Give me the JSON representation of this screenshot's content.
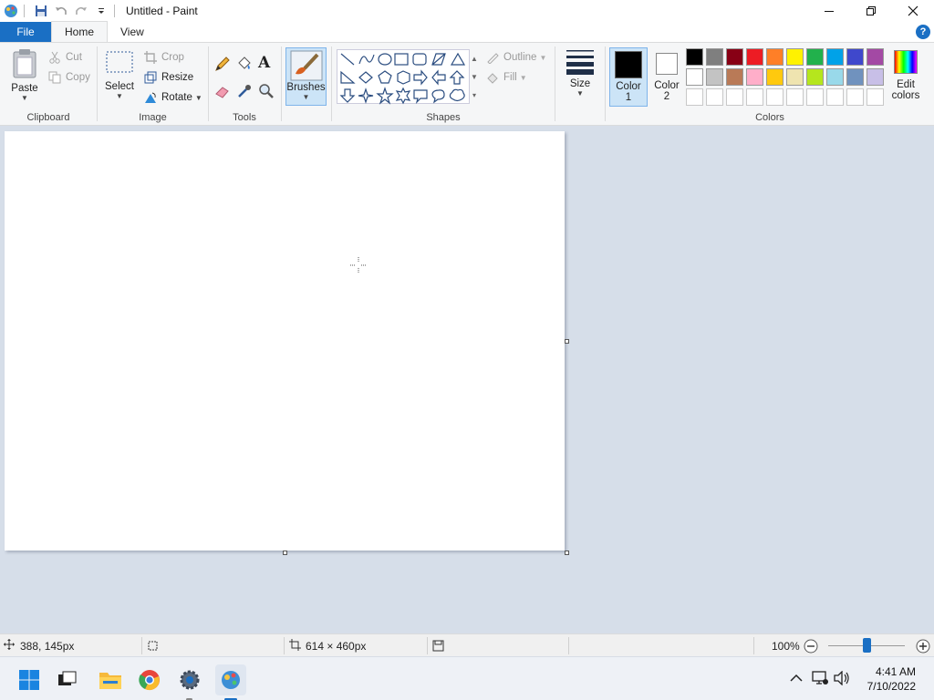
{
  "window": {
    "title": "Untitled - Paint"
  },
  "tabs": {
    "file": "File",
    "home": "Home",
    "view": "View"
  },
  "clipboard": {
    "group_label": "Clipboard",
    "paste": "Paste",
    "cut": "Cut",
    "copy": "Copy"
  },
  "image": {
    "group_label": "Image",
    "select": "Select",
    "crop": "Crop",
    "resize": "Resize",
    "rotate": "Rotate"
  },
  "tools": {
    "group_label": "Tools"
  },
  "brushes": {
    "label": "Brushes"
  },
  "shapes": {
    "group_label": "Shapes",
    "outline": "Outline",
    "fill": "Fill"
  },
  "size": {
    "label": "Size"
  },
  "colors": {
    "group_label": "Colors",
    "color1_label": "Color",
    "color1_num": "1",
    "color2_label": "Color",
    "color2_num": "2",
    "edit_label": "Edit",
    "edit_label2": "colors",
    "color1": "#000000",
    "color2": "#ffffff",
    "palette_row1": [
      "#000000",
      "#7f7f7f",
      "#880015",
      "#ed1c24",
      "#ff7f27",
      "#fff200",
      "#22b14c",
      "#00a2e8",
      "#3f48cc",
      "#a349a4"
    ],
    "palette_row2": [
      "#ffffff",
      "#c3c3c3",
      "#b97a57",
      "#ffaec9",
      "#ffc90e",
      "#efe4b0",
      "#b5e61d",
      "#99d9ea",
      "#7092be",
      "#c8bfe7"
    ],
    "palette_row3": [
      "#ffffff",
      "#ffffff",
      "#ffffff",
      "#ffffff",
      "#ffffff",
      "#ffffff",
      "#ffffff",
      "#ffffff",
      "#ffffff",
      "#ffffff"
    ]
  },
  "status": {
    "cursor_pos": "388, 145px",
    "canvas_size": "614 × 460px",
    "zoom": "100%"
  },
  "taskbar": {
    "time": "4:41 AM",
    "date": "7/10/2022"
  }
}
